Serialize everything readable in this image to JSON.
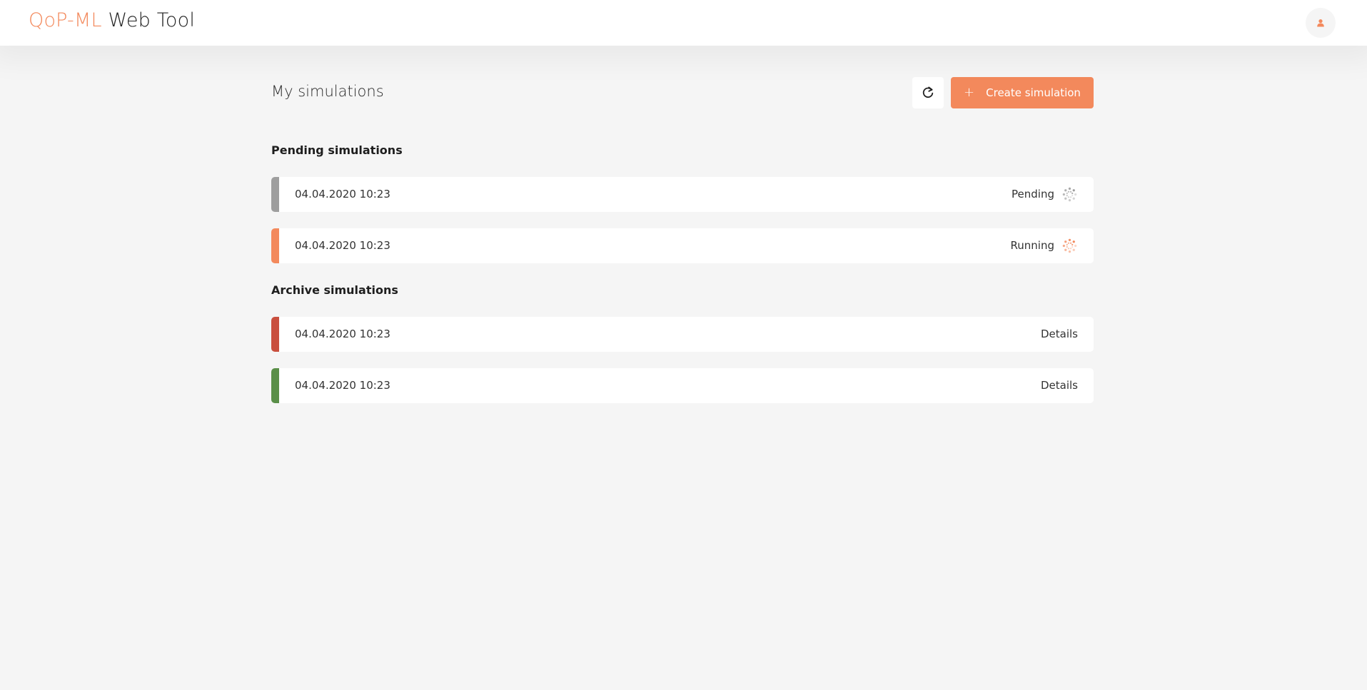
{
  "app": {
    "brand_accent": "QoP-ML",
    "brand_rest": "Web Tool"
  },
  "header": {
    "avatar_icon": "user-icon"
  },
  "main": {
    "title": "My simulations",
    "refresh_icon": "refresh-icon",
    "create_label": "Create simulation",
    "create_icon": "plus-icon"
  },
  "pending": {
    "title": "Pending simulations",
    "items": [
      {
        "date": "04.04.2020 10:23",
        "status": "Pending",
        "color": "#9e9e9e",
        "icon": "spinner-icon"
      },
      {
        "date": "04.04.2020 10:23",
        "status": "Running",
        "color": "#f3895c",
        "icon": "spinner-icon"
      }
    ]
  },
  "archive": {
    "title": "Archive simulations",
    "items": [
      {
        "date": "04.04.2020 10:23",
        "action": "Details",
        "color": "#c94f3e"
      },
      {
        "date": "04.04.2020 10:23",
        "action": "Details",
        "color": "#5a8f48"
      }
    ]
  },
  "colors": {
    "accent": "#f3895c",
    "background": "#f5f5f5"
  }
}
